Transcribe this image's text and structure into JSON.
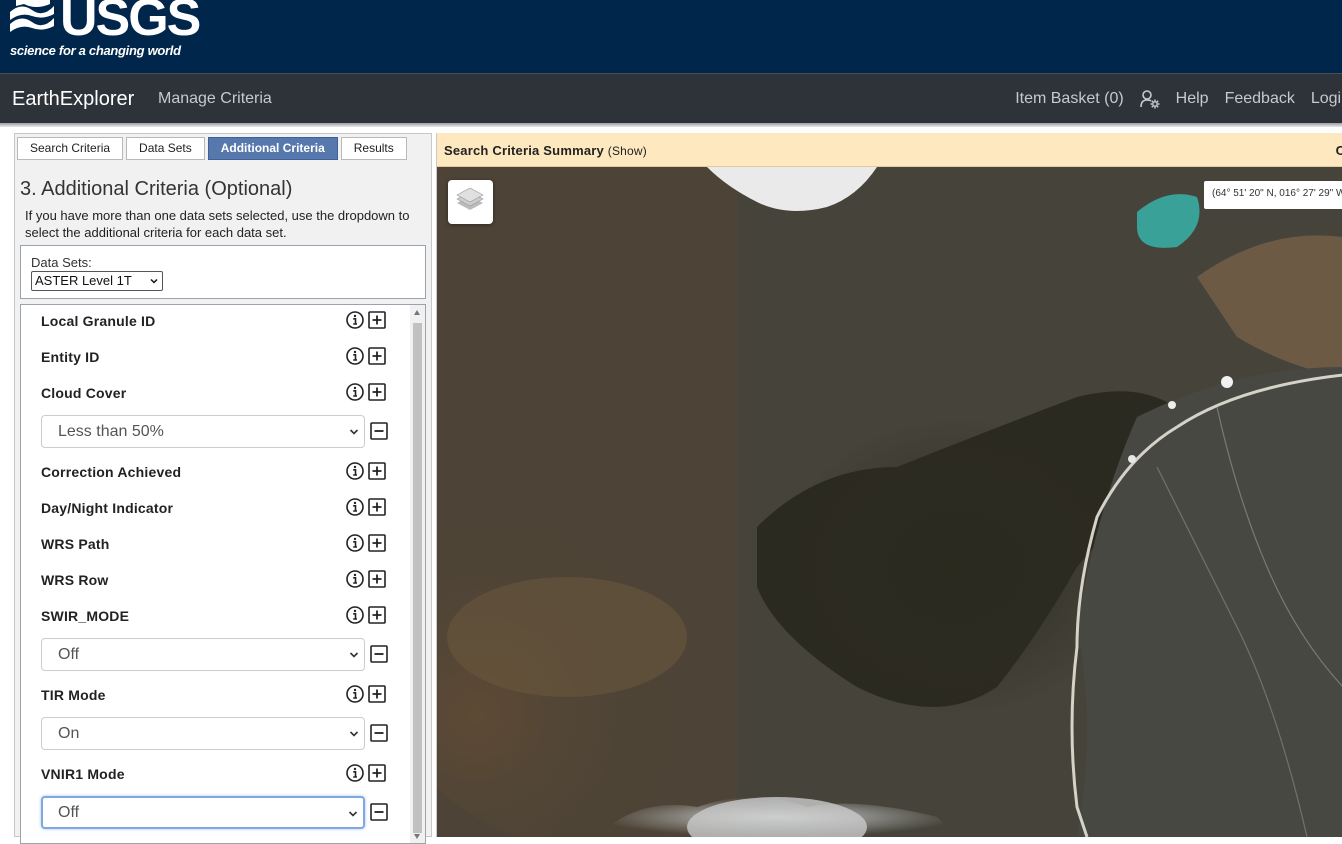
{
  "brand": {
    "wordmark": "USGS",
    "tagline": "science for a changing world"
  },
  "nav": {
    "app_title": "EarthExplorer",
    "manage_criteria": "Manage Criteria",
    "item_basket": "Item Basket (0)",
    "help": "Help",
    "feedback": "Feedback",
    "login": "Login"
  },
  "tabs": [
    {
      "label": "Search Criteria",
      "active": false
    },
    {
      "label": "Data Sets",
      "active": false
    },
    {
      "label": "Additional Criteria",
      "active": true
    },
    {
      "label": "Results",
      "active": false
    }
  ],
  "panel": {
    "title": "3. Additional Criteria (Optional)",
    "description": "If you have more than one data sets selected, use the dropdown to select the additional criteria for each data set.",
    "datasets_label": "Data Sets:",
    "datasets_selected": "ASTER Level 1T"
  },
  "criteria": [
    {
      "label": "Local Granule ID"
    },
    {
      "label": "Entity ID"
    },
    {
      "label": "Cloud Cover",
      "value": "Less than 50%"
    },
    {
      "label": "Correction Achieved"
    },
    {
      "label": "Day/Night Indicator"
    },
    {
      "label": "WRS Path"
    },
    {
      "label": "WRS Row"
    },
    {
      "label": "SWIR_MODE",
      "value": "Off"
    },
    {
      "label": "TIR Mode",
      "value": "On"
    },
    {
      "label": "VNIR1 Mode",
      "value": "Off"
    }
  ],
  "map": {
    "summary_title": "Search Criteria Summary",
    "summary_show": "(Show)",
    "summary_right": "C",
    "coordinates": "(64° 51' 20\" N, 016° 27' 29\" W)"
  },
  "colors": {
    "usgs_blue": "#00264c",
    "nav_gray": "#2e3339",
    "tab_active": "#5778ad",
    "summary_bar": "#fde8bf"
  }
}
